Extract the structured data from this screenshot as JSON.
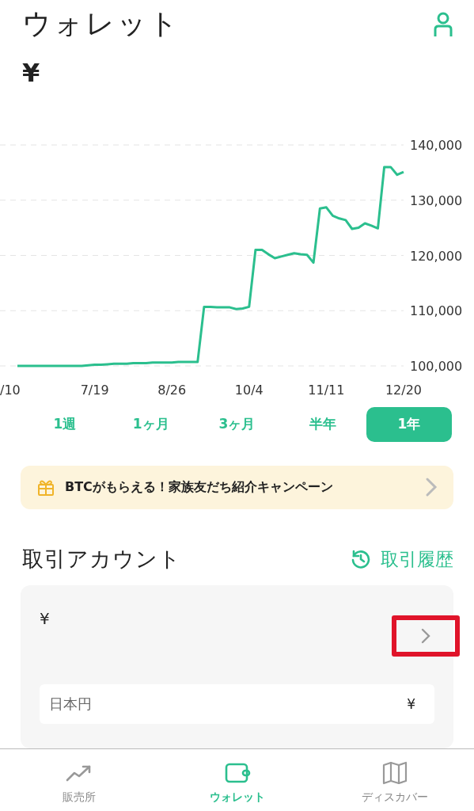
{
  "header": {
    "title": "ウォレット"
  },
  "balance": {
    "currency": "¥"
  },
  "chart": {
    "chart_data": {
      "type": "line",
      "categories": [
        "/10",
        null,
        null,
        null,
        null,
        null,
        null,
        null,
        null,
        null,
        null,
        null,
        "7/19",
        null,
        null,
        null,
        null,
        null,
        null,
        null,
        null,
        null,
        null,
        null,
        "8/26",
        null,
        null,
        null,
        null,
        null,
        null,
        null,
        null,
        null,
        null,
        null,
        "10/4",
        null,
        null,
        null,
        null,
        null,
        null,
        null,
        null,
        null,
        null,
        null,
        "11/11",
        null,
        null,
        null,
        null,
        null,
        null,
        null,
        null,
        null,
        null,
        null,
        "12/20"
      ],
      "series": [
        {
          "color": "#2bbf8e",
          "values": [
            100000,
            100000,
            100000,
            100000,
            100000,
            100000,
            100000,
            100000,
            100000,
            100000,
            100000,
            100100,
            100200,
            100200,
            100300,
            100400,
            100400,
            100400,
            100500,
            100500,
            100500,
            100600,
            100600,
            100600,
            100600,
            100700,
            100700,
            100700,
            100700,
            110700,
            110700,
            110600,
            110600,
            110600,
            110300,
            110400,
            110700,
            121000,
            121000,
            120200,
            119500,
            119800,
            120100,
            120400,
            120200,
            120100,
            118700,
            128500,
            128700,
            127200,
            126700,
            126400,
            124800,
            125000,
            125800,
            125400,
            124900,
            136000,
            136000,
            134600,
            135100
          ]
        }
      ],
      "grid": true,
      "ylim": [
        100000,
        140000
      ],
      "yticks": [
        {
          "value": 100000,
          "label": "100,000"
        },
        {
          "value": 110000,
          "label": "110,000"
        },
        {
          "value": 120000,
          "label": "120,000"
        },
        {
          "value": 130000,
          "label": "130,000"
        },
        {
          "value": 140000,
          "label": "140,000"
        }
      ]
    }
  },
  "range_tabs": [
    {
      "label": "1週",
      "selected": false
    },
    {
      "label": "1ヶ月",
      "selected": false
    },
    {
      "label": "3ヶ月",
      "selected": false
    },
    {
      "label": "半年",
      "selected": false
    },
    {
      "label": "1年",
      "selected": true
    }
  ],
  "banner": {
    "text": "BTCがもらえる！家族友だち紹介キャンペーン"
  },
  "section": {
    "title": "取引アカウント",
    "history_link": "取引履歴"
  },
  "account_card": {
    "currency": "¥",
    "chevron_highlighted": true,
    "rows": [
      {
        "label": "日本円",
        "value": "¥"
      }
    ]
  },
  "bottom_nav": [
    {
      "kind": "trend",
      "label": "販売所",
      "selected": false
    },
    {
      "kind": "wallet",
      "label": "ウォレット",
      "selected": true
    },
    {
      "kind": "map",
      "label": "ディスカバー",
      "selected": false
    }
  ]
}
